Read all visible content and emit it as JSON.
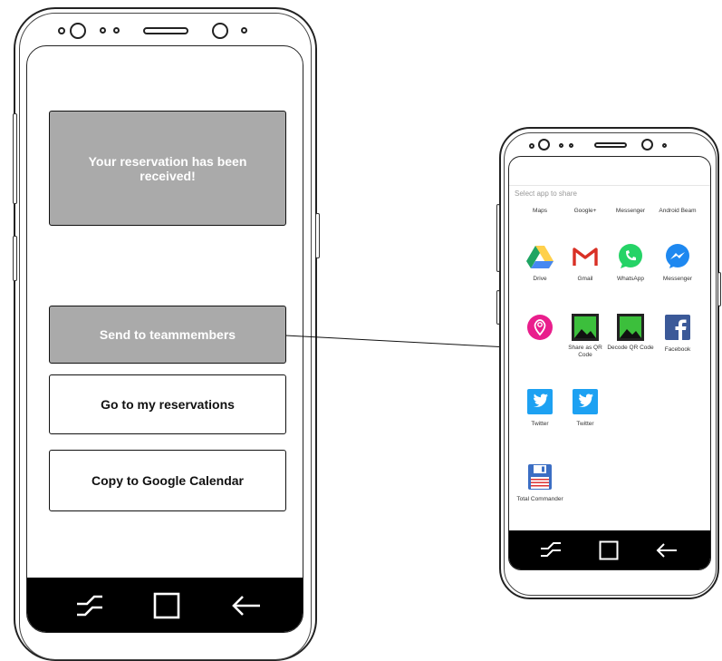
{
  "left_phone": {
    "confirmation_message": "Your reservation has been received!",
    "send_button": "Send to teammembers",
    "reservations_button": "Go to my reservations",
    "calendar_button": "Copy to Google Calendar"
  },
  "share_sheet": {
    "title": "Select app to share",
    "partial_row": [
      "Maps",
      "Google+",
      "Messenger",
      "Android Beam"
    ],
    "apps": [
      {
        "label": "Drive",
        "icon": "google-drive-icon"
      },
      {
        "label": "Gmail",
        "icon": "gmail-icon"
      },
      {
        "label": "WhatsApp",
        "icon": "whatsapp-icon"
      },
      {
        "label": "Messenger",
        "icon": "messenger-icon"
      },
      {
        "label": "",
        "icon": "location-pin-icon"
      },
      {
        "label": "Share as QR Code",
        "icon": "image-icon"
      },
      {
        "label": "Decode QR Code",
        "icon": "image-icon"
      },
      {
        "label": "Facebook",
        "icon": "facebook-icon"
      },
      {
        "label": "Twitter",
        "icon": "twitter-icon"
      },
      {
        "label": "Twitter",
        "icon": "twitter-icon"
      },
      {
        "label": "Total Commander",
        "icon": "floppy-disk-icon"
      }
    ]
  },
  "colors": {
    "gray_button": "#aaaaaa",
    "nav_bar": "#000000",
    "drive_green": "#1fa463",
    "drive_yellow": "#ffd04b",
    "drive_blue": "#4688f1",
    "gmail_red": "#d93025",
    "whatsapp_green": "#25d366",
    "messenger_blue": "#1e88f0",
    "facebook_blue": "#3b5998",
    "twitter_blue": "#1da1f2",
    "pin_pink": "#e91e8c",
    "commander_blue": "#3b6ec4"
  }
}
